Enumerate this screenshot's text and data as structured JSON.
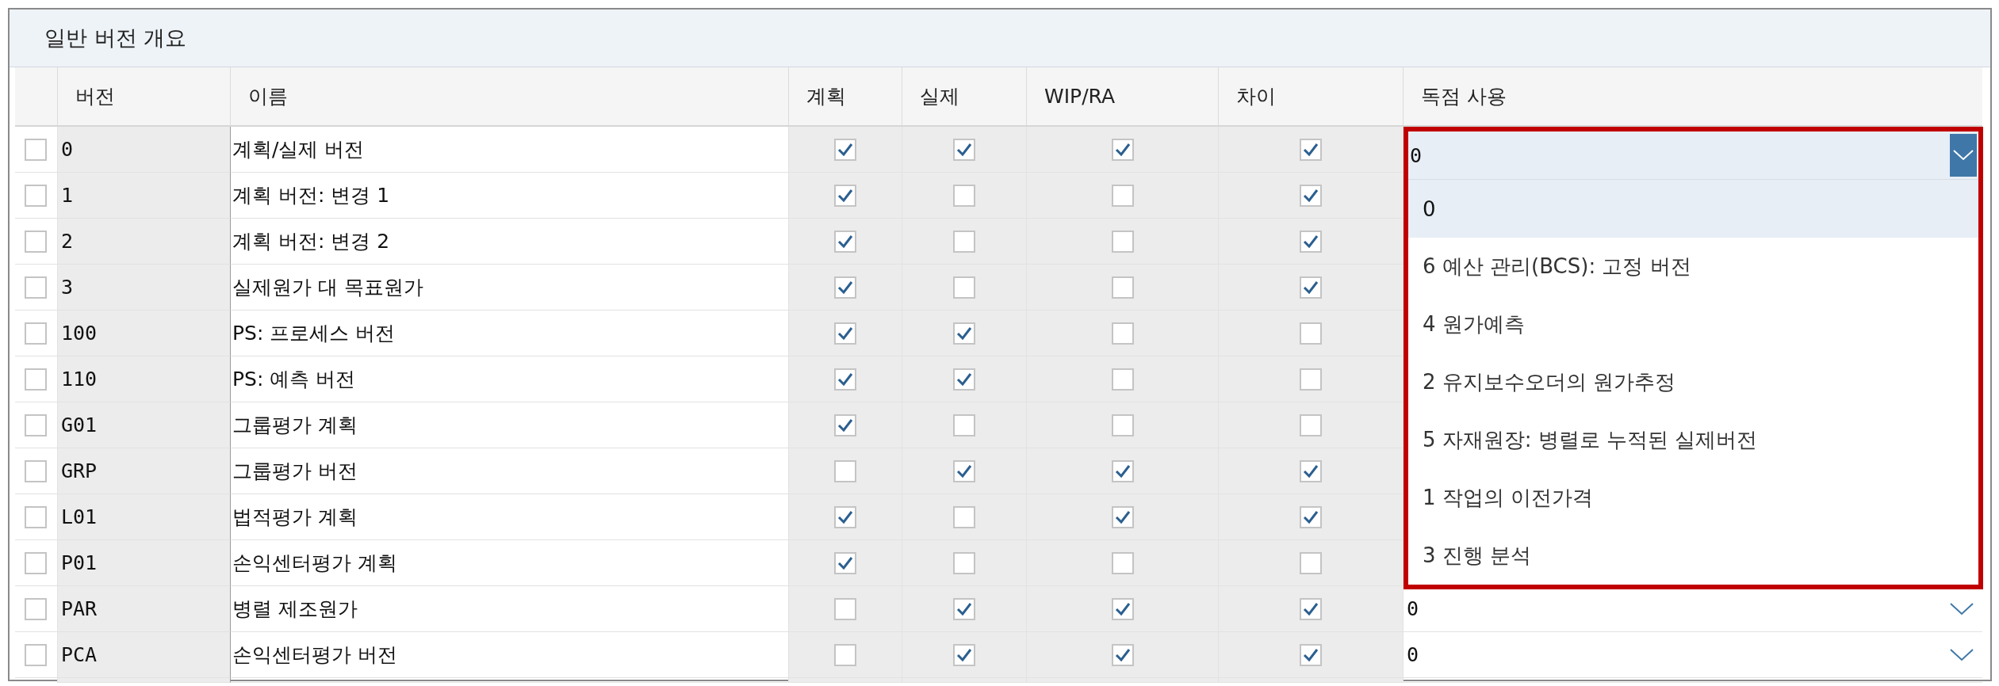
{
  "panel": {
    "title": "일반 버전 개요"
  },
  "columns": [
    "버전",
    "이름",
    "계획",
    "실제",
    "WIP/RA",
    "차이",
    "독점 사용"
  ],
  "rows": [
    {
      "selected": false,
      "version": "0",
      "name": "계획/실제 버전",
      "plan": true,
      "actual": true,
      "wip": true,
      "variance": true,
      "exclusive_dropdown": {
        "value": "0",
        "expanded": true,
        "options": [
          {
            "label": "0",
            "selected": true
          },
          {
            "label": "6 예산 관리(BCS): 고정 버전",
            "selected": false
          },
          {
            "label": "4 원가예측",
            "selected": false
          },
          {
            "label": "2 유지보수오더의 원가추정",
            "selected": false
          },
          {
            "label": "5 자재원장: 병렬로 누적된 실제버전",
            "selected": false
          },
          {
            "label": "1 작업의 이전가격",
            "selected": false
          },
          {
            "label": "3 진행 분석",
            "selected": false
          }
        ]
      }
    },
    {
      "selected": false,
      "version": "1",
      "name": "계획 버전: 변경 1",
      "plan": true,
      "actual": false,
      "wip": false,
      "variance": true
    },
    {
      "selected": false,
      "version": "2",
      "name": "계획 버전: 변경 2",
      "plan": true,
      "actual": false,
      "wip": false,
      "variance": true
    },
    {
      "selected": false,
      "version": "3",
      "name": "실제원가 대 목표원가",
      "plan": true,
      "actual": false,
      "wip": false,
      "variance": true
    },
    {
      "selected": false,
      "version": "100",
      "name": "PS: 프로세스 버전",
      "plan": true,
      "actual": true,
      "wip": false,
      "variance": false
    },
    {
      "selected": false,
      "version": "110",
      "name": "PS: 예측 버전",
      "plan": true,
      "actual": true,
      "wip": false,
      "variance": false
    },
    {
      "selected": false,
      "version": "G01",
      "name": "그룹평가 계획",
      "plan": true,
      "actual": false,
      "wip": false,
      "variance": false
    },
    {
      "selected": false,
      "version": "GRP",
      "name": "그룹평가 버전",
      "plan": false,
      "actual": true,
      "wip": true,
      "variance": true
    },
    {
      "selected": false,
      "version": "L01",
      "name": "법적평가 계획",
      "plan": true,
      "actual": false,
      "wip": true,
      "variance": true
    },
    {
      "selected": false,
      "version": "P01",
      "name": "손익센터평가 계획",
      "plan": true,
      "actual": false,
      "wip": false,
      "variance": false
    },
    {
      "selected": false,
      "version": "PAR",
      "name": "병렬 제조원가",
      "plan": false,
      "actual": true,
      "wip": true,
      "variance": true,
      "exclusive": "0"
    },
    {
      "selected": false,
      "version": "PCA",
      "name": "손익센터평가 버전",
      "plan": false,
      "actual": true,
      "wip": true,
      "variance": true,
      "exclusive": "0"
    }
  ]
}
